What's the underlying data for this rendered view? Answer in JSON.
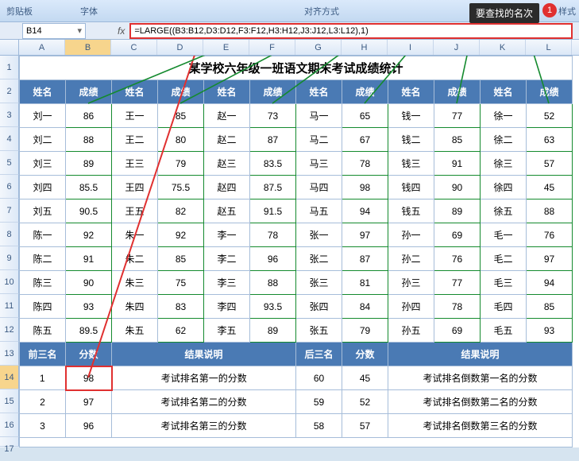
{
  "ribbon": {
    "g1": "剪贴板",
    "g2": "字体",
    "g3": "对齐方式",
    "g4": "样式"
  },
  "namebox": "B14",
  "fx": "fx",
  "formula": "=LARGE((B3:B12,D3:D12,F3:F12,H3:H12,J3:J12,L3:L12),1)",
  "callout": "要查找的名次",
  "badge": "1",
  "cols": [
    "A",
    "B",
    "C",
    "D",
    "E",
    "F",
    "G",
    "H",
    "I",
    "J",
    "K",
    "L"
  ],
  "title": "某学校六年级一班语文期末考试成绩统计",
  "hdr": [
    "姓名",
    "成绩",
    "姓名",
    "成绩",
    "姓名",
    "成绩",
    "姓名",
    "成绩",
    "姓名",
    "成绩",
    "姓名",
    "成绩"
  ],
  "rows": [
    [
      "刘一",
      "86",
      "王一",
      "85",
      "赵一",
      "73",
      "马一",
      "65",
      "钱一",
      "77",
      "徐一",
      "52"
    ],
    [
      "刘二",
      "88",
      "王二",
      "80",
      "赵二",
      "87",
      "马二",
      "67",
      "钱二",
      "85",
      "徐二",
      "63"
    ],
    [
      "刘三",
      "89",
      "王三",
      "79",
      "赵三",
      "83.5",
      "马三",
      "78",
      "钱三",
      "91",
      "徐三",
      "57"
    ],
    [
      "刘四",
      "85.5",
      "王四",
      "75.5",
      "赵四",
      "87.5",
      "马四",
      "98",
      "钱四",
      "90",
      "徐四",
      "45"
    ],
    [
      "刘五",
      "90.5",
      "王五",
      "82",
      "赵五",
      "91.5",
      "马五",
      "94",
      "钱五",
      "89",
      "徐五",
      "88"
    ],
    [
      "陈一",
      "92",
      "朱一",
      "92",
      "李一",
      "78",
      "张一",
      "97",
      "孙一",
      "69",
      "毛一",
      "76"
    ],
    [
      "陈二",
      "91",
      "朱二",
      "85",
      "李二",
      "96",
      "张二",
      "87",
      "孙二",
      "76",
      "毛二",
      "97"
    ],
    [
      "陈三",
      "90",
      "朱三",
      "75",
      "李三",
      "88",
      "张三",
      "81",
      "孙三",
      "77",
      "毛三",
      "94"
    ],
    [
      "陈四",
      "93",
      "朱四",
      "83",
      "李四",
      "93.5",
      "张四",
      "84",
      "孙四",
      "78",
      "毛四",
      "85"
    ],
    [
      "陈五",
      "89.5",
      "朱五",
      "62",
      "李五",
      "89",
      "张五",
      "79",
      "孙五",
      "69",
      "毛五",
      "93"
    ]
  ],
  "sumhdr": [
    "前三名",
    "分数",
    "结果说明",
    "后三名",
    "分数",
    "结果说明"
  ],
  "sumrows": [
    [
      "1",
      "98",
      "考试排名第一的分数",
      "60",
      "45",
      "考试排名倒数第一名的分数"
    ],
    [
      "2",
      "97",
      "考试排名第二的分数",
      "59",
      "52",
      "考试排名倒数第二名的分数"
    ],
    [
      "3",
      "96",
      "考试排名第三的分数",
      "58",
      "57",
      "考试排名倒数第三名的分数"
    ]
  ],
  "chart_data": {
    "type": "table",
    "title": "某学校六年级一班语文期末考试成绩统计",
    "columns": [
      "姓名",
      "成绩"
    ],
    "students": [
      {
        "name": "刘一",
        "score": 86
      },
      {
        "name": "刘二",
        "score": 88
      },
      {
        "name": "刘三",
        "score": 89
      },
      {
        "name": "刘四",
        "score": 85.5
      },
      {
        "name": "刘五",
        "score": 90.5
      },
      {
        "name": "陈一",
        "score": 92
      },
      {
        "name": "陈二",
        "score": 91
      },
      {
        "name": "陈三",
        "score": 90
      },
      {
        "name": "陈四",
        "score": 93
      },
      {
        "name": "陈五",
        "score": 89.5
      },
      {
        "name": "王一",
        "score": 85
      },
      {
        "name": "王二",
        "score": 80
      },
      {
        "name": "王三",
        "score": 79
      },
      {
        "name": "王四",
        "score": 75.5
      },
      {
        "name": "王五",
        "score": 82
      },
      {
        "name": "朱一",
        "score": 92
      },
      {
        "name": "朱二",
        "score": 85
      },
      {
        "name": "朱三",
        "score": 75
      },
      {
        "name": "朱四",
        "score": 83
      },
      {
        "name": "朱五",
        "score": 62
      },
      {
        "name": "赵一",
        "score": 73
      },
      {
        "name": "赵二",
        "score": 87
      },
      {
        "name": "赵三",
        "score": 83.5
      },
      {
        "name": "赵四",
        "score": 87.5
      },
      {
        "name": "赵五",
        "score": 91.5
      },
      {
        "name": "李一",
        "score": 78
      },
      {
        "name": "李二",
        "score": 96
      },
      {
        "name": "李三",
        "score": 88
      },
      {
        "name": "李四",
        "score": 93.5
      },
      {
        "name": "李五",
        "score": 89
      },
      {
        "name": "马一",
        "score": 65
      },
      {
        "name": "马二",
        "score": 67
      },
      {
        "name": "马三",
        "score": 78
      },
      {
        "name": "马四",
        "score": 98
      },
      {
        "name": "马五",
        "score": 94
      },
      {
        "name": "张一",
        "score": 97
      },
      {
        "name": "张二",
        "score": 87
      },
      {
        "name": "张三",
        "score": 81
      },
      {
        "name": "张四",
        "score": 84
      },
      {
        "name": "张五",
        "score": 79
      },
      {
        "name": "钱一",
        "score": 77
      },
      {
        "name": "钱二",
        "score": 85
      },
      {
        "name": "钱三",
        "score": 91
      },
      {
        "name": "钱四",
        "score": 90
      },
      {
        "name": "钱五",
        "score": 89
      },
      {
        "name": "孙一",
        "score": 69
      },
      {
        "name": "孙二",
        "score": 76
      },
      {
        "name": "孙三",
        "score": 77
      },
      {
        "name": "孙四",
        "score": 78
      },
      {
        "name": "孙五",
        "score": 69
      },
      {
        "name": "徐一",
        "score": 52
      },
      {
        "name": "徐二",
        "score": 63
      },
      {
        "name": "徐三",
        "score": 57
      },
      {
        "name": "徐四",
        "score": 45
      },
      {
        "name": "徐五",
        "score": 88
      },
      {
        "name": "毛一",
        "score": 76
      },
      {
        "name": "毛二",
        "score": 97
      },
      {
        "name": "毛三",
        "score": 94
      },
      {
        "name": "毛四",
        "score": 85
      },
      {
        "name": "毛五",
        "score": 93
      }
    ],
    "top3": [
      {
        "rank": 1,
        "score": 98
      },
      {
        "rank": 2,
        "score": 97
      },
      {
        "rank": 3,
        "score": 96
      }
    ],
    "bottom3": [
      {
        "rank": 60,
        "score": 45
      },
      {
        "rank": 59,
        "score": 52
      },
      {
        "rank": 58,
        "score": 57
      }
    ]
  }
}
